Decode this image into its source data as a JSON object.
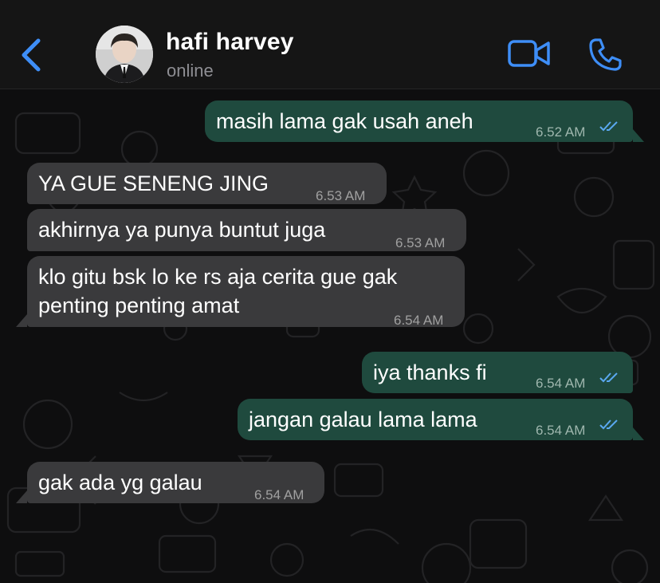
{
  "contact": {
    "name": "hafi harvey",
    "status": "online"
  },
  "icons": {
    "back": "chevron-left-icon",
    "video": "video-camera-icon",
    "call": "phone-icon",
    "read": "double-check-icon"
  },
  "colors": {
    "accent": "#3e8ef7",
    "outgoing_bubble": "#1f4a3e",
    "incoming_bubble": "#3a3a3c",
    "read_ticks": "#5aa8f0"
  },
  "messages": [
    {
      "direction": "outgoing",
      "text": "masih lama gak usah aneh",
      "time": "6.52 AM",
      "read": true
    },
    {
      "direction": "incoming",
      "text": "YA GUE SENENG JING",
      "time": "6.53 AM"
    },
    {
      "direction": "incoming",
      "text": "akhirnya ya punya buntut juga",
      "time": "6.53 AM"
    },
    {
      "direction": "incoming",
      "text_line1": "klo gitu bsk lo ke rs aja cerita gue gak",
      "text_line2": "penting penting amat",
      "time": "6.54 AM"
    },
    {
      "direction": "outgoing",
      "text": "iya thanks fi",
      "time": "6.54 AM",
      "read": true
    },
    {
      "direction": "outgoing",
      "text": "jangan galau lama lama",
      "time": "6.54 AM",
      "read": true
    },
    {
      "direction": "incoming",
      "text": "gak ada yg galau",
      "time": "6.54 AM"
    }
  ]
}
